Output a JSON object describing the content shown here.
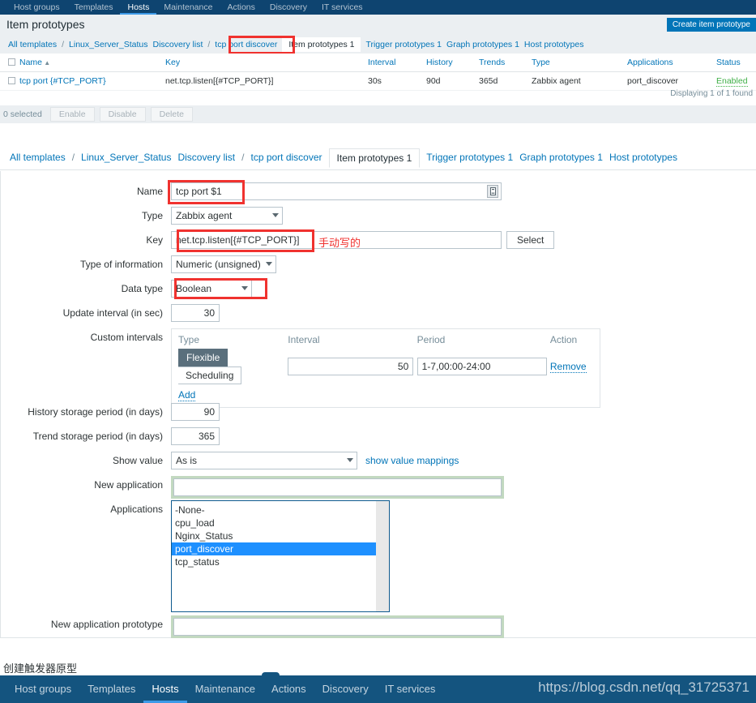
{
  "top_nav": {
    "items": [
      {
        "label": "Host groups",
        "active": false
      },
      {
        "label": "Templates",
        "active": false
      },
      {
        "label": "Hosts",
        "active": true
      },
      {
        "label": "Maintenance",
        "active": false
      },
      {
        "label": "Actions",
        "active": false
      },
      {
        "label": "Discovery",
        "active": false
      },
      {
        "label": "IT services",
        "active": false
      }
    ]
  },
  "header": {
    "title": "Item prototypes",
    "create_button": "Create item prototype"
  },
  "breadcrumb_list": {
    "items": [
      {
        "label": "All templates",
        "type": "link"
      },
      {
        "label": "/",
        "type": "sep"
      },
      {
        "label": "Linux_Server_Status",
        "type": "link"
      },
      {
        "label": "Discovery list",
        "type": "link"
      },
      {
        "label": "/",
        "type": "sep"
      },
      {
        "label": "tcp port discover",
        "type": "link"
      },
      {
        "label": "Item prototypes 1",
        "type": "current"
      },
      {
        "label": "Trigger prototypes 1",
        "type": "link"
      },
      {
        "label": "Graph prototypes 1",
        "type": "link"
      },
      {
        "label": "Host prototypes",
        "type": "link"
      }
    ]
  },
  "list_table": {
    "columns": [
      "Name",
      "Key",
      "Interval",
      "History",
      "Trends",
      "Type",
      "Applications",
      "Status"
    ],
    "sort_indicator": "▲",
    "rows": [
      {
        "name": "tcp port {#TCP_PORT}",
        "key": "net.tcp.listen[{#TCP_PORT}]",
        "interval": "30s",
        "history": "90d",
        "trends": "365d",
        "type": "Zabbix agent",
        "applications": "port_discover",
        "status": "Enabled"
      }
    ],
    "displaying": "Displaying 1 of 1 found"
  },
  "action_bar": {
    "selected_text": "0 selected",
    "buttons": [
      "Enable",
      "Disable",
      "Delete"
    ]
  },
  "breadcrumb_form": {
    "items": [
      {
        "label": "All templates",
        "type": "link"
      },
      {
        "label": "/",
        "type": "sep"
      },
      {
        "label": "Linux_Server_Status",
        "type": "link"
      },
      {
        "label": "Discovery list",
        "type": "link"
      },
      {
        "label": "/",
        "type": "sep"
      },
      {
        "label": "tcp port discover",
        "type": "link"
      },
      {
        "label": "Item prototypes 1",
        "type": "current"
      },
      {
        "label": "Trigger prototypes 1",
        "type": "link"
      },
      {
        "label": "Graph prototypes 1",
        "type": "link"
      },
      {
        "label": "Host prototypes",
        "type": "link"
      }
    ]
  },
  "form": {
    "name": {
      "label": "Name",
      "value": "tcp port $1"
    },
    "type": {
      "label": "Type",
      "value": "Zabbix agent"
    },
    "key": {
      "label": "Key",
      "value": "net.tcp.listen[{#TCP_PORT}]",
      "select_button": "Select",
      "annotation": "手动写的"
    },
    "type_of_information": {
      "label": "Type of information",
      "value": "Numeric (unsigned)"
    },
    "data_type": {
      "label": "Data type",
      "value": "Boolean"
    },
    "update_interval": {
      "label": "Update interval (in sec)",
      "value": "30"
    },
    "custom_intervals": {
      "label": "Custom intervals",
      "headers": [
        "Type",
        "Interval",
        "Period",
        "Action"
      ],
      "rows": [
        {
          "type_flexible": "Flexible",
          "type_scheduling": "Scheduling",
          "interval": "50",
          "period": "1-7,00:00-24:00",
          "action": "Remove"
        }
      ],
      "add_link": "Add"
    },
    "history_storage": {
      "label": "History storage period (in days)",
      "value": "90"
    },
    "trend_storage": {
      "label": "Trend storage period (in days)",
      "value": "365"
    },
    "show_value": {
      "label": "Show value",
      "value": "As is",
      "link": "show value mappings"
    },
    "new_application": {
      "label": "New application",
      "value": "",
      "placeholder": ""
    },
    "applications": {
      "label": "Applications",
      "options": [
        "-None-",
        "cpu_load",
        "Nginx_Status",
        "port_discover",
        "tcp_status"
      ],
      "selected": "port_discover"
    },
    "new_application_prototype": {
      "label": "New application prototype",
      "value": "",
      "placeholder": ""
    }
  },
  "caption": "创建触发器原型",
  "bottom_nav": {
    "items": [
      {
        "label": "Host groups",
        "active": false
      },
      {
        "label": "Templates",
        "active": false
      },
      {
        "label": "Hosts",
        "active": true
      },
      {
        "label": "Maintenance",
        "active": false
      },
      {
        "label": "Actions",
        "active": false
      },
      {
        "label": "Discovery",
        "active": false
      },
      {
        "label": "IT services",
        "active": false
      }
    ],
    "watermark": "https://blog.csdn.net/qq_31725371"
  },
  "colors": {
    "nav_bg": "#0e4470",
    "nav_bg_bottom": "#14547f",
    "accent_link": "#0275b8",
    "accent_underline": "#3d9ae8",
    "strip_bg": "#ebeff2",
    "annotation_red": "#f0322f",
    "highlight_green": "#c2d9c0",
    "select_blue": "#1e90ff",
    "status_green": "#3faf46"
  }
}
